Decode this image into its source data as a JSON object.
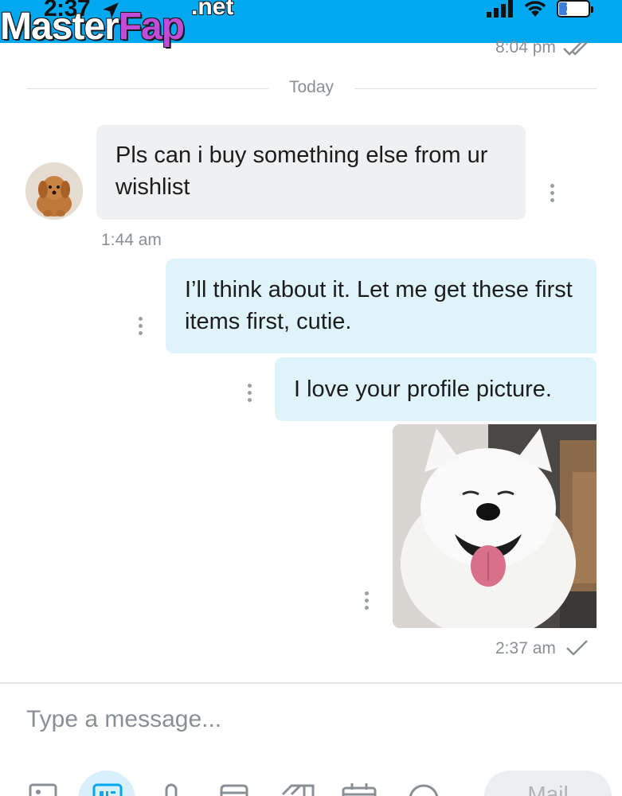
{
  "status_bar": {
    "time": "2:37",
    "battery": "27",
    "battery_level": 0.27
  },
  "watermark": {
    "main": "Master",
    "accent": "Fap",
    "suffix": ".net"
  },
  "previous_message": {
    "time": "8:04 pm"
  },
  "divider": {
    "label": "Today"
  },
  "messages": [
    {
      "direction": "incoming",
      "text": "Pls can i buy something else from ur wishlist",
      "time": "1:44 am"
    },
    {
      "direction": "outgoing",
      "text": "I’ll think about it. Let me get these first items first, cutie."
    },
    {
      "direction": "outgoing",
      "text": "I love your profile picture."
    },
    {
      "direction": "outgoing",
      "type": "photo",
      "time": "2:37 am"
    }
  ],
  "composer": {
    "placeholder": "Type a message...",
    "send_label": "Mail"
  },
  "toolbar_icons": [
    "image-icon",
    "gif-icon",
    "microphone-icon",
    "vault-icon",
    "tag-icon",
    "calendar-icon",
    "dollar-icon"
  ],
  "colors": {
    "accent": "#00a8f0",
    "outgoing_bubble": "#dff4fa",
    "incoming_bubble": "#eef0f2"
  }
}
